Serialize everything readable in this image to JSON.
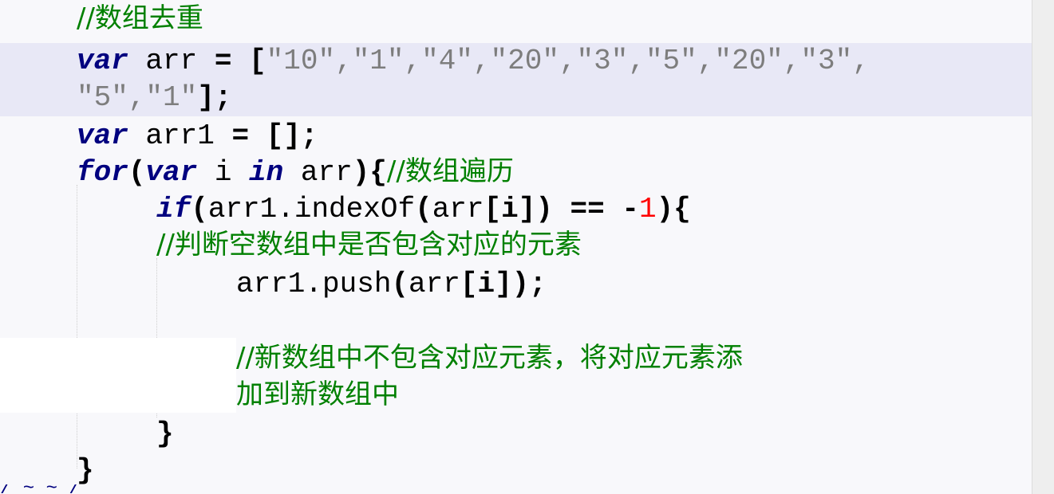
{
  "code": {
    "comment_dedupe": "//数组去重",
    "l2": {
      "kw": "var",
      "name": " arr ",
      "eq": "=",
      "sp": " ",
      "open": "[",
      "items": "\"10\",\"1\",\"4\",\"20\",\"3\",\"5\",\"20\",\"3\",",
      "cont": "\"5\",\"1\"",
      "close": "];"
    },
    "l3": {
      "kw": "var",
      "name": " arr1 ",
      "eq": "=",
      "rest": " [];"
    },
    "l4": {
      "kw_for": "for",
      "paren": "(",
      "kw_var": "var",
      "i": " i ",
      "kw_in": "in",
      "arr": " arr",
      "brace": "){",
      "comment": "//数组遍历"
    },
    "l5": {
      "kw_if": "if",
      "open": "(",
      "call": "arr1.indexOf",
      "open2": "(",
      "arr": "arr",
      "idx": "[i]",
      "close": ")",
      "eqeq": " == ",
      "minus": "-",
      "one": "1",
      "end": "){"
    },
    "comment_check": "//判断空数组中是否包含对应的元素",
    "l7": {
      "call": "arr1.push",
      "open": "(",
      "arr": "arr",
      "idx": "[i]",
      "close": ");"
    },
    "comment_add_1": "//新数组中不包含对应元素，将对应元素添",
    "comment_add_2": "加到新数组中",
    "close_if": "}",
    "close_for": "}",
    "bottom_fragment": "/ ~ ~ /"
  },
  "colors": {
    "keyword": "#00007f",
    "comment": "#008000",
    "string": "#7d7d7d",
    "number": "#ff0000",
    "line_highlight": "#e8e8f6"
  }
}
